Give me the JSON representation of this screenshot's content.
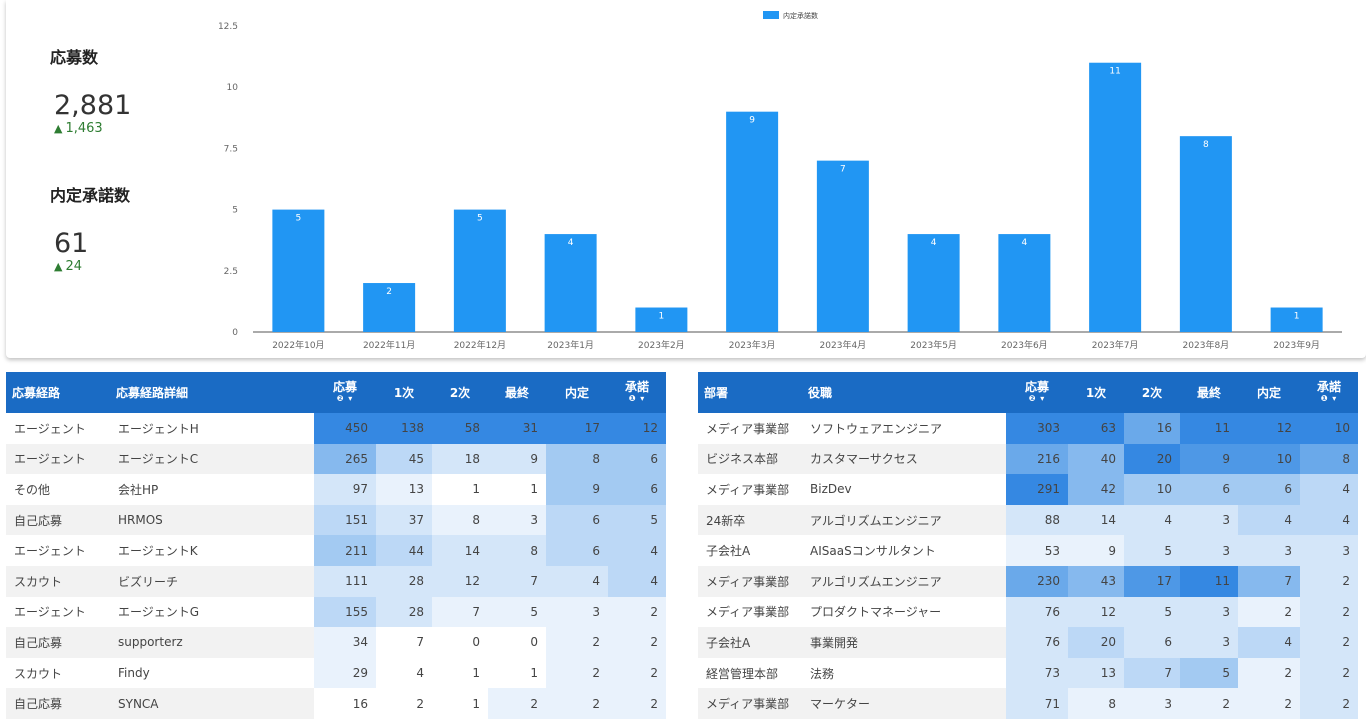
{
  "kpis": [
    {
      "title": "応募数",
      "value": "2,881",
      "delta": "1,463"
    },
    {
      "title": "内定承諾数",
      "value": "61",
      "delta": "24"
    }
  ],
  "chart_data": {
    "type": "bar",
    "categories": [
      "2022年10月",
      "2022年11月",
      "2022年12月",
      "2023年1月",
      "2023年2月",
      "2023年3月",
      "2023年4月",
      "2023年5月",
      "2023年6月",
      "2023年7月",
      "2023年8月",
      "2023年9月"
    ],
    "series": [
      {
        "name": "内定承諾数",
        "values": [
          5,
          2,
          5,
          4,
          1,
          9,
          7,
          4,
          4,
          11,
          8,
          1
        ]
      }
    ],
    "yticks": [
      "0",
      "2.5",
      "5",
      "7.5",
      "10",
      "12.5"
    ],
    "ylim": [
      0,
      12.5
    ],
    "legend": "top-center",
    "bar_color": "#2196f3"
  },
  "colors": {
    "header_bg": "#1a6bc4",
    "heat_scale": [
      "#ffffff",
      "#e9f2fc",
      "#d4e6f9",
      "#bcd8f6",
      "#a3caf2",
      "#86b9ee",
      "#6aa9ea",
      "#4e98e6",
      "#3588e2"
    ]
  },
  "table_left": {
    "headers": [
      "応募経路",
      "応募経路詳細"
    ],
    "num_headers": [
      {
        "label": "応募",
        "sub": "❷ ▾"
      },
      {
        "label": "1次",
        "sub": ""
      },
      {
        "label": "2次",
        "sub": ""
      },
      {
        "label": "最終",
        "sub": ""
      },
      {
        "label": "内定",
        "sub": ""
      },
      {
        "label": "承諾",
        "sub": "❶ ▾"
      }
    ],
    "rows": [
      {
        "a": "エージェント",
        "b": "エージェントH",
        "v": [
          450,
          138,
          58,
          31,
          17,
          12
        ]
      },
      {
        "a": "エージェント",
        "b": "エージェントC",
        "v": [
          265,
          45,
          18,
          9,
          8,
          6
        ]
      },
      {
        "a": "その他",
        "b": "会社HP",
        "v": [
          97,
          13,
          1,
          1,
          9,
          6
        ]
      },
      {
        "a": "自己応募",
        "b": "HRMOS",
        "v": [
          151,
          37,
          8,
          3,
          6,
          5
        ]
      },
      {
        "a": "エージェント",
        "b": "エージェントK",
        "v": [
          211,
          44,
          14,
          8,
          6,
          4
        ]
      },
      {
        "a": "スカウト",
        "b": "ビズリーチ",
        "v": [
          111,
          28,
          12,
          7,
          4,
          4
        ]
      },
      {
        "a": "エージェント",
        "b": "エージェントG",
        "v": [
          155,
          28,
          7,
          5,
          3,
          2
        ]
      },
      {
        "a": "自己応募",
        "b": "supporterz",
        "v": [
          34,
          7,
          0,
          0,
          2,
          2
        ]
      },
      {
        "a": "スカウト",
        "b": "Findy",
        "v": [
          29,
          4,
          1,
          1,
          2,
          2
        ]
      },
      {
        "a": "自己応募",
        "b": "SYNCA",
        "v": [
          16,
          2,
          1,
          2,
          2,
          2
        ]
      }
    ]
  },
  "table_right": {
    "headers": [
      "部署",
      "役職"
    ],
    "num_headers": [
      {
        "label": "応募",
        "sub": "❷ ▾"
      },
      {
        "label": "1次",
        "sub": ""
      },
      {
        "label": "2次",
        "sub": ""
      },
      {
        "label": "最終",
        "sub": ""
      },
      {
        "label": "内定",
        "sub": ""
      },
      {
        "label": "承諾",
        "sub": "❶ ▾"
      }
    ],
    "rows": [
      {
        "a": "メディア事業部",
        "b": "ソフトウェアエンジニア",
        "v": [
          303,
          63,
          16,
          11,
          12,
          10
        ]
      },
      {
        "a": "ビジネス本部",
        "b": "カスタマーサクセス",
        "v": [
          216,
          40,
          20,
          9,
          10,
          8
        ]
      },
      {
        "a": "メディア事業部",
        "b": "BizDev",
        "v": [
          291,
          42,
          10,
          6,
          6,
          4
        ]
      },
      {
        "a": "24新卒",
        "b": "アルゴリズムエンジニア",
        "v": [
          88,
          14,
          4,
          3,
          4,
          4
        ]
      },
      {
        "a": "子会社A",
        "b": "AISaaSコンサルタント",
        "v": [
          53,
          9,
          5,
          3,
          3,
          3
        ]
      },
      {
        "a": "メディア事業部",
        "b": "アルゴリズムエンジニア",
        "v": [
          230,
          43,
          17,
          11,
          7,
          2
        ]
      },
      {
        "a": "メディア事業部",
        "b": "プロダクトマネージャー",
        "v": [
          76,
          12,
          5,
          3,
          2,
          2
        ]
      },
      {
        "a": "子会社A",
        "b": "事業開発",
        "v": [
          76,
          20,
          6,
          3,
          4,
          2
        ]
      },
      {
        "a": "経営管理本部",
        "b": "法務",
        "v": [
          73,
          13,
          7,
          5,
          2,
          2
        ]
      },
      {
        "a": "メディア事業部",
        "b": "マーケター",
        "v": [
          71,
          8,
          3,
          2,
          2,
          2
        ]
      }
    ]
  }
}
